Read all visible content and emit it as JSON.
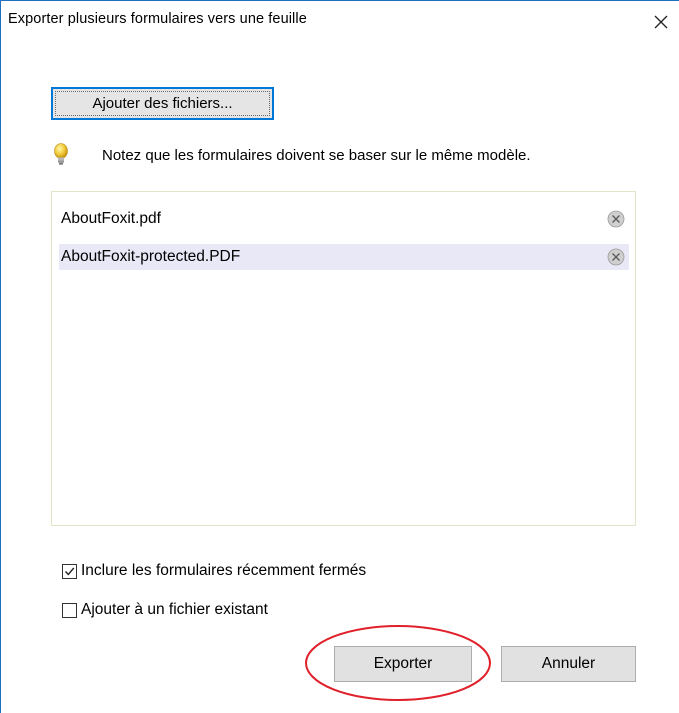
{
  "dialog": {
    "title": "Exporter plusieurs formulaires vers une feuille",
    "close_icon": "close-icon"
  },
  "add_files_button": {
    "label": "Ajouter des fichiers..."
  },
  "note": {
    "icon": "lightbulb-icon",
    "text": "Notez que les formulaires doivent se baser sur le même modèle."
  },
  "files": [
    {
      "name": "AboutFoxit.pdf",
      "selected": false,
      "remove_icon": "remove-circle-x-icon"
    },
    {
      "name": "AboutFoxit-protected.PDF",
      "selected": true,
      "remove_icon": "remove-circle-x-icon"
    }
  ],
  "options": {
    "include_closed": {
      "label": "Inclure les formulaires récemment fermés",
      "checked": true
    },
    "append_existing": {
      "label": "Ajouter à un fichier existant",
      "checked": false
    }
  },
  "buttons": {
    "export_label": "Exporter",
    "cancel_label": "Annuler"
  },
  "colors": {
    "window_border": "#1f6fbf",
    "focus_border": "#0078d7",
    "selection": "#e8e8f7",
    "annotation_ellipse": "#e0202a"
  }
}
